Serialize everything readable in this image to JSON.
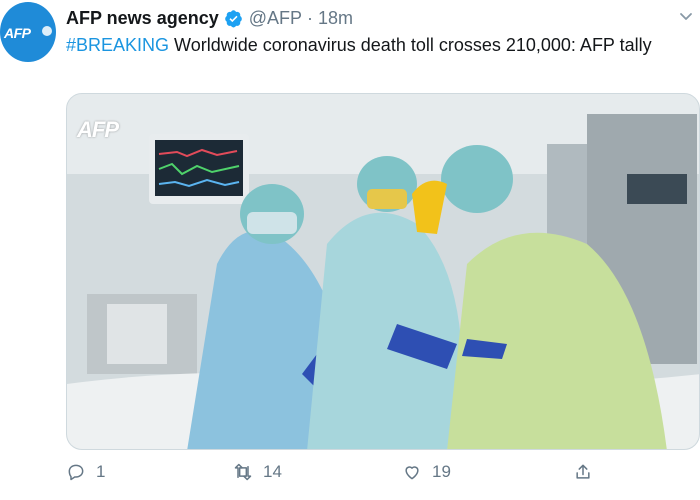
{
  "account": {
    "display_name": "AFP news agency",
    "handle": "@AFP",
    "separator": "·",
    "time": "18m",
    "avatar_text": "AFP"
  },
  "tweet": {
    "hashtag": "#BREAKING",
    "text": " Worldwide coronavirus death toll crosses 210,000: AFP tally"
  },
  "media": {
    "watermark": "AFP"
  },
  "actions": {
    "replies": "1",
    "retweets": "14",
    "likes": "19"
  },
  "colors": {
    "brand": "#1f8bd8",
    "link": "#1b95e0",
    "muted": "#657786"
  }
}
